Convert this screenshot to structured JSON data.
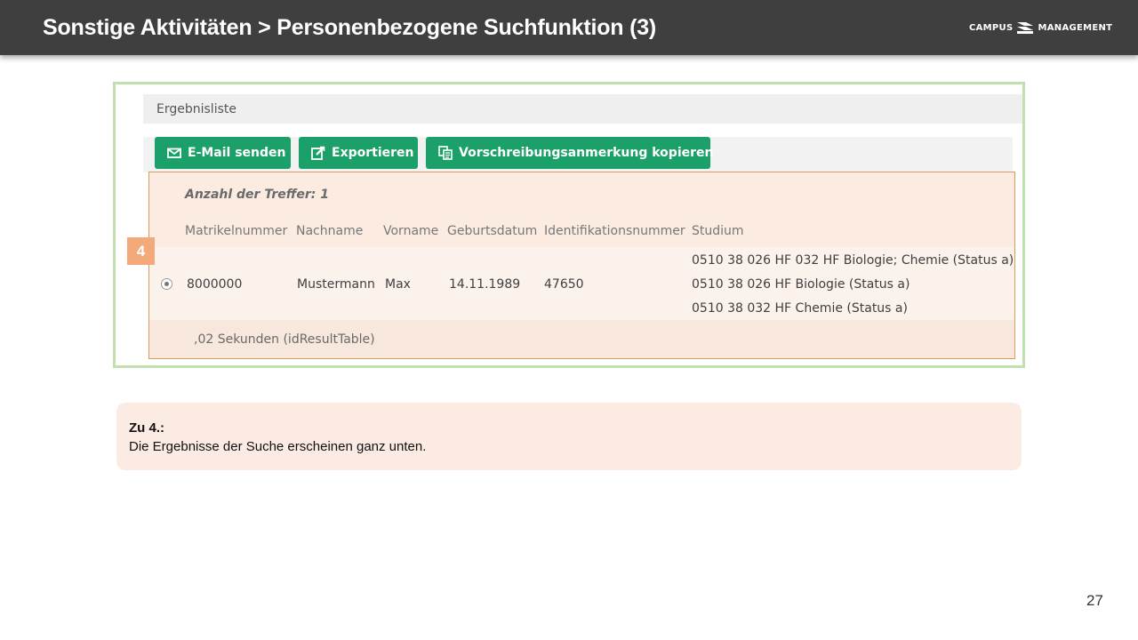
{
  "header": {
    "title": "Sonstige Aktivitäten > Personenbezogene Suchfunktion (3)",
    "logo_left": "CAMPUS",
    "logo_right": "MANAGEMENT"
  },
  "panel": {
    "title": "Ergebnisliste"
  },
  "toolbar": {
    "email_label": "E-Mail senden",
    "export_label": "Exportieren",
    "copy_label": "Vorschreibungsanmerkung kopieren"
  },
  "results": {
    "hits_label": "Anzahl der Treffer: 1",
    "columns": [
      "Matrikelnummer",
      "Nachname",
      "Vorname",
      "Geburtsdatum",
      "Identifikationsnummer",
      "Studium"
    ],
    "row": {
      "matrikelnummer": "8000000",
      "nachname": "Mustermann",
      "vorname": "Max",
      "geburtsdatum": "14.11.1989",
      "identifikationsnummer": "47650",
      "studium": [
        "0510 38 026 HF 032 HF Biologie; Chemie (Status a)",
        "0510 38 026 HF Biologie (Status a)",
        "0510 38 032 HF Chemie (Status a)"
      ]
    },
    "timing": ",02 Sekunden (idResultTable)"
  },
  "marker": {
    "number": "4",
    "color": "#f3a97a"
  },
  "note": {
    "title": "Zu 4.:",
    "text": "Die Ergebnisse der Suche erscheinen ganz unten."
  },
  "page_number": "27",
  "colors": {
    "header_bg": "#3f3f3f",
    "button_green": "#1aa068",
    "frame_border": "#c2dfb0",
    "highlight_bg": "#fbebe1",
    "highlight_border": "#d99a5f"
  }
}
